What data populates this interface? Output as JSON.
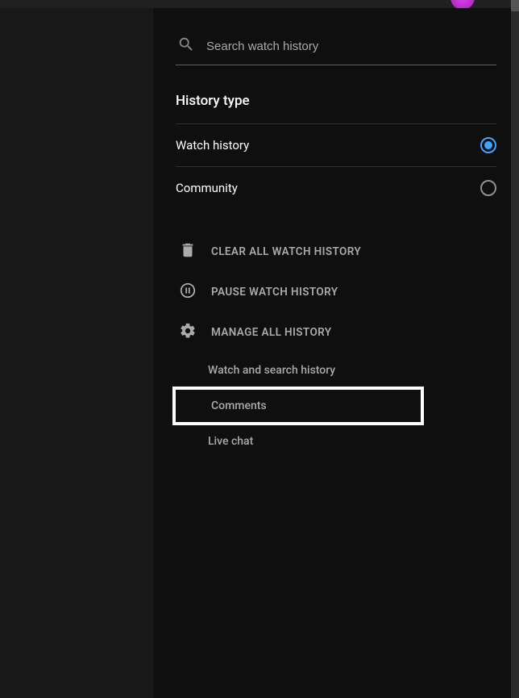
{
  "search": {
    "placeholder": "Search watch history"
  },
  "history_type": {
    "title": "History type",
    "options": {
      "watch": {
        "label": "Watch history",
        "selected": true
      },
      "community": {
        "label": "Community",
        "selected": false
      }
    }
  },
  "actions": {
    "clear": "CLEAR ALL WATCH HISTORY",
    "pause": "PAUSE WATCH HISTORY",
    "manage": "MANAGE ALL HISTORY"
  },
  "sublinks": {
    "watch_search": "Watch and search history",
    "comments": "Comments",
    "live_chat": "Live chat"
  }
}
